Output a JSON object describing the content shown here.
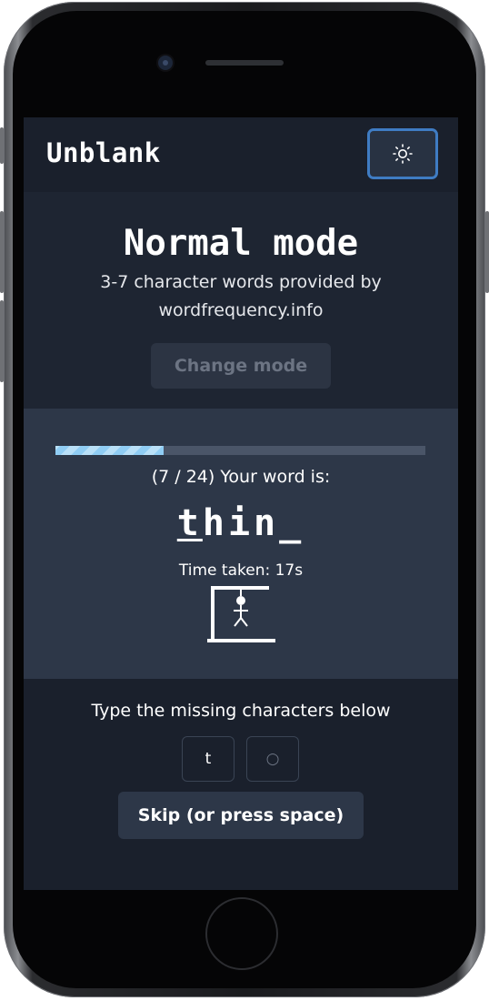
{
  "app": {
    "title": "Unblank",
    "theme_toggle_icon": "sun-icon"
  },
  "mode": {
    "title": "Normal mode",
    "description": "3-7 character words provided by wordfrequency.info",
    "change_button_label": "Change mode"
  },
  "game": {
    "progress_fraction": 0.2917,
    "word_count_text": "(7 / 24) Your word is:",
    "word_letters": [
      {
        "char": "t",
        "underlined": true
      },
      {
        "char": "h",
        "underlined": false
      },
      {
        "char": "i",
        "underlined": false
      },
      {
        "char": "n",
        "underlined": false
      },
      {
        "char": "_",
        "underlined": false
      }
    ],
    "time_text": "Time taken: 17s",
    "hangman_icon": "hangman-figure-icon"
  },
  "input": {
    "instructions": "Type the missing characters below",
    "chars": [
      {
        "value": "t",
        "placeholder": ""
      },
      {
        "value": "",
        "placeholder": "○"
      }
    ],
    "skip_label": "Skip (or press space)"
  },
  "colors": {
    "background": "#1a202c",
    "game_panel": "#2d3748",
    "accent_progress": "#90cdf4",
    "focus_ring": "#3f7cc3"
  }
}
